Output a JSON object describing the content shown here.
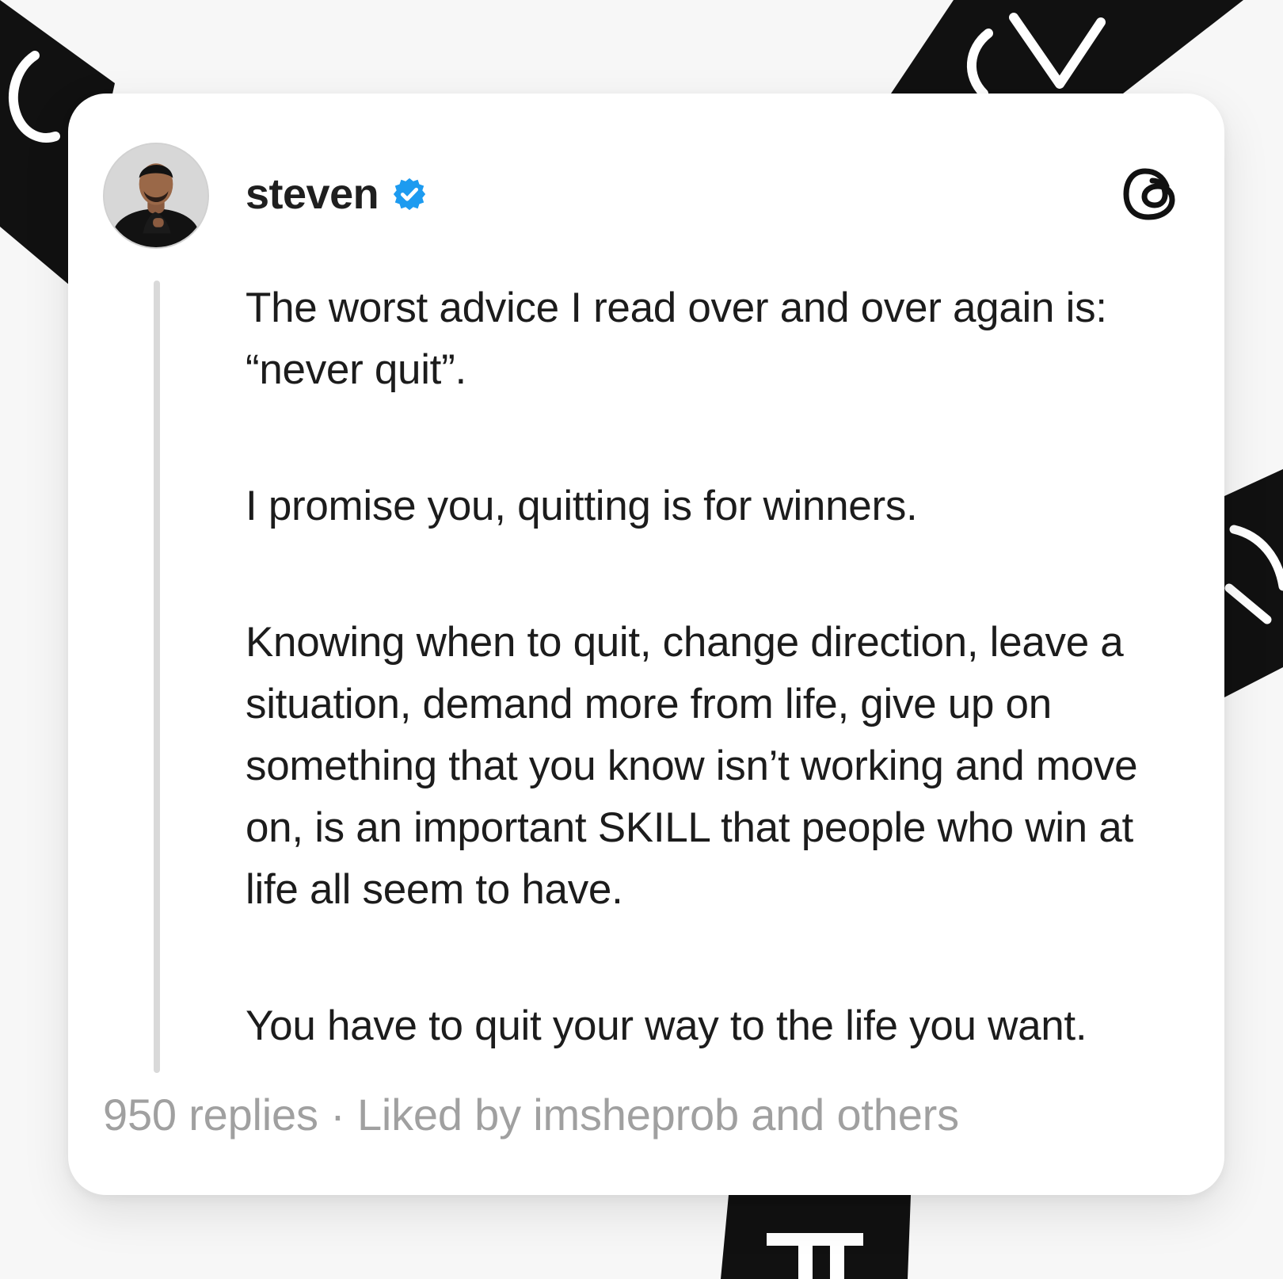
{
  "post": {
    "username": "steven",
    "verified": true,
    "paragraphs": [
      "The worst advice I read over and over again is: “never quit”.",
      "I promise you, quitting is for winners.",
      "Knowing when to quit, change direction, leave a situation, demand more from life, give up on something that you know isn’t working and move on, is an important SKILL that people who win at life all seem to have.",
      "You have to quit your way to the life you want."
    ],
    "replies": "950 replies",
    "separator": " · ",
    "liked_by": "Liked by imsheprob and others"
  },
  "icons": {
    "verified": "verified-badge-icon",
    "app_logo": "threads-logo-icon"
  },
  "colors": {
    "verified_blue": "#1d9bf0",
    "text_primary": "#1c1c1c",
    "text_secondary": "#a0a0a0",
    "thread_line": "#d9d9d9",
    "card_background": "#ffffff",
    "background_shapes": "#111111"
  }
}
